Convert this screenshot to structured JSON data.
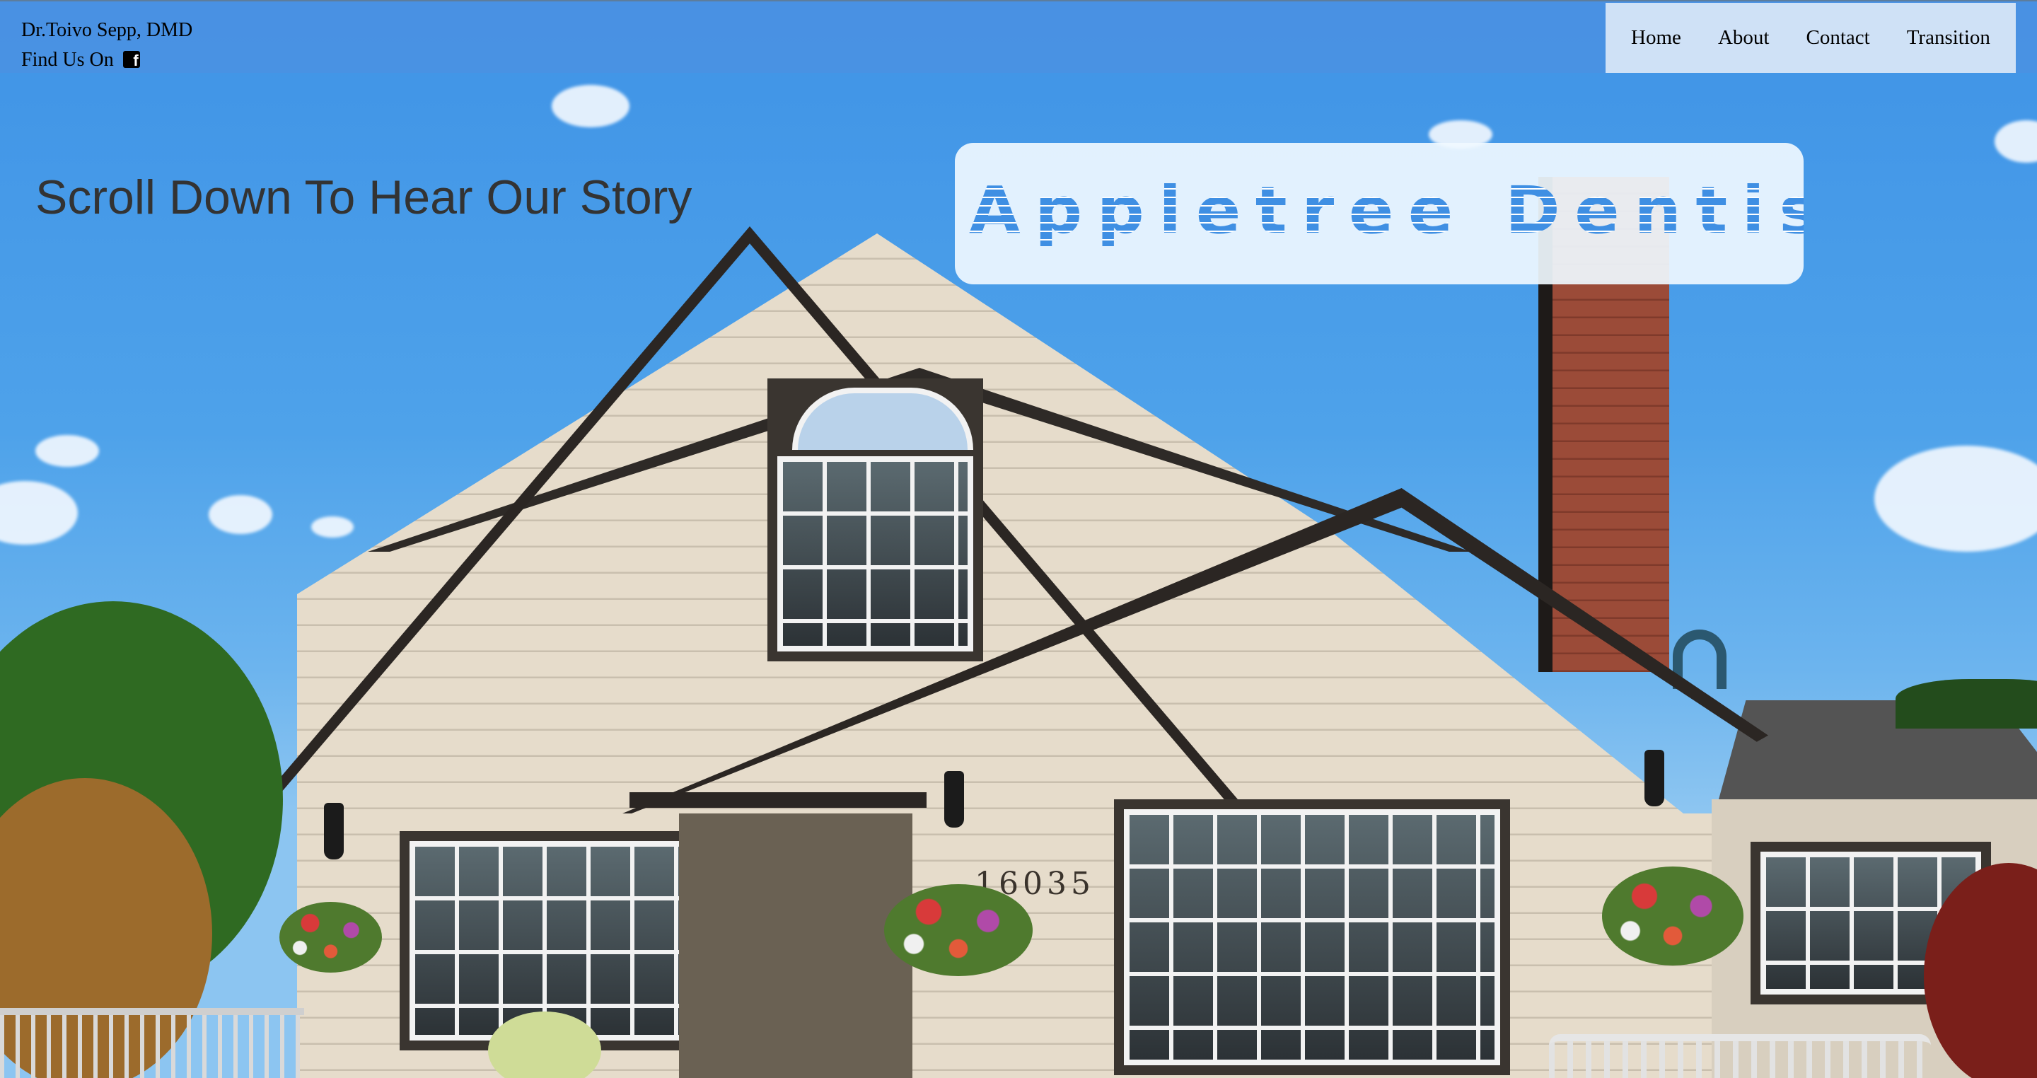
{
  "header": {
    "doctor_name": "Dr.Toivo Sepp, DMD",
    "find_us_label": "Find Us On",
    "social_icon": "facebook-icon"
  },
  "nav": {
    "items": [
      {
        "label": "Home"
      },
      {
        "label": "About"
      },
      {
        "label": "Contact"
      },
      {
        "label": "Transition"
      }
    ]
  },
  "hero": {
    "tagline": "Scroll Down To Hear Our Story",
    "logo_text": "Appletree Dentistry",
    "house_number": "16035"
  },
  "colors": {
    "header_bg": "#4a91e2",
    "nav_bg": "#cfe1f6",
    "logo_blue": "#3f8fe3",
    "tagline": "#333333"
  }
}
